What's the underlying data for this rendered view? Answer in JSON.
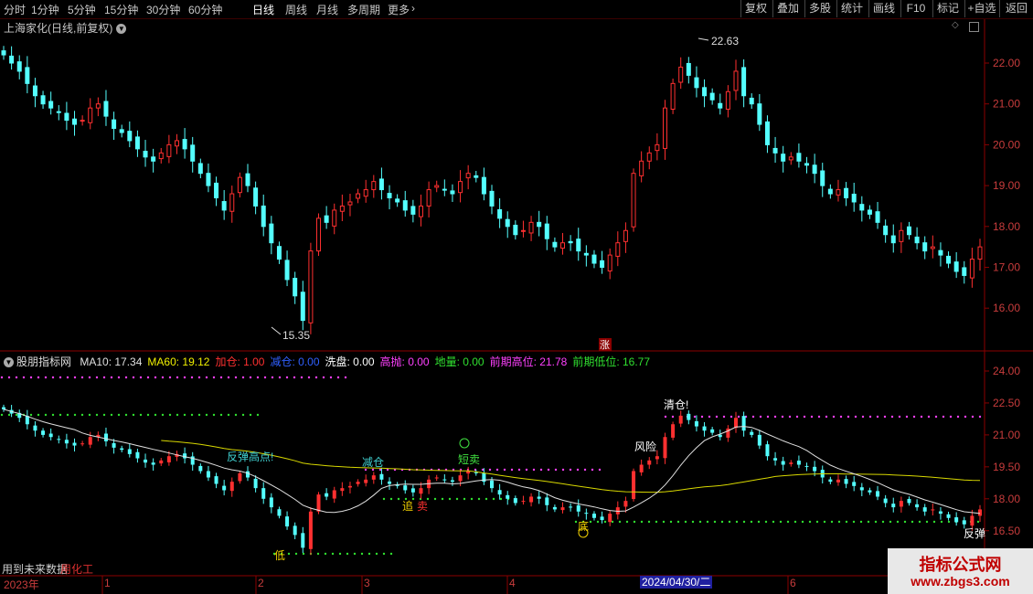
{
  "toolbar": {
    "timeframes": [
      "分时",
      "1分钟",
      "5分钟",
      "15分钟",
      "30分钟",
      "60分钟",
      "日线",
      "周线",
      "月线",
      "多周期",
      "更多"
    ],
    "active_timeframe": "日线",
    "buttons": [
      "复权",
      "叠加",
      "多股",
      "统计",
      "画线",
      "F10",
      "标记",
      "+自选",
      "返回"
    ]
  },
  "stock_title": "上海家化(日线,前复权)",
  "price_axis": [
    "22.00",
    "21.00",
    "20.00",
    "19.00",
    "18.00",
    "17.00",
    "16.00"
  ],
  "high_label": "22.63",
  "low_label": "15.35",
  "limit_up_badge": "涨",
  "indicator": {
    "name": "股朋指标网",
    "items": [
      {
        "label": "MA10:",
        "value": "17.34",
        "color": "#e0e0e0"
      },
      {
        "label": "MA60:",
        "value": "19.12",
        "color": "#f0f000"
      },
      {
        "label": "加仓:",
        "value": "1.00",
        "color": "#ff3030"
      },
      {
        "label": "减仓:",
        "value": "0.00",
        "color": "#3060ff"
      },
      {
        "label": "洗盘:",
        "value": "0.00",
        "color": "#ffffff"
      },
      {
        "label": "高抛:",
        "value": "0.00",
        "color": "#ff40ff"
      },
      {
        "label": "地量:",
        "value": "0.00",
        "color": "#30e030"
      },
      {
        "label": "前期高位:",
        "value": "21.78",
        "color": "#ff40ff"
      },
      {
        "label": "前期低位:",
        "value": "16.77",
        "color": "#30e030"
      }
    ],
    "axis": [
      "24.00",
      "22.50",
      "21.00",
      "19.50",
      "18.00",
      "16.50"
    ],
    "annotations": {
      "rebound_high": "反弹高点!",
      "reduce": "减仓",
      "short_sell": "短卖",
      "clear": "清仓!",
      "risk": "风险",
      "bottom1": "低",
      "bottom2": "底",
      "chase": "追",
      "sell": "卖",
      "rebound": "反弹"
    }
  },
  "date_axis": {
    "year": "2023年",
    "months": [
      "1",
      "2",
      "3",
      "4",
      "6"
    ],
    "selected_date": "2024/04/30/二"
  },
  "footer_note": "用到未来数据",
  "footer_note2": "用化工",
  "watermark": {
    "line1": "指标公式网",
    "line2": "www.zbgs3.com"
  },
  "colors": {
    "up": "#ff3030",
    "down": "#54ffff",
    "ma_short": "#e0e0e0",
    "ma_long": "#d8d800",
    "high_dots": "#ff40ff",
    "low_dots": "#30e030",
    "border": "#8b0000"
  },
  "candle_closes": [
    22.2,
    22.0,
    21.8,
    21.5,
    21.2,
    21.0,
    20.9,
    20.8,
    20.6,
    20.5,
    20.6,
    20.9,
    21.0,
    20.7,
    20.4,
    20.3,
    20.1,
    19.9,
    19.7,
    19.6,
    19.8,
    20.0,
    20.1,
    19.9,
    19.6,
    19.3,
    19.0,
    18.7,
    18.4,
    18.8,
    19.2,
    19.0,
    18.5,
    18.0,
    17.6,
    17.2,
    16.7,
    16.3,
    15.7,
    17.4,
    18.2,
    18.1,
    18.4,
    18.5,
    18.6,
    18.8,
    18.9,
    19.1,
    18.9,
    18.7,
    18.6,
    18.4,
    18.3,
    18.5,
    18.9,
    19.0,
    18.9,
    18.8,
    19.1,
    19.3,
    19.2,
    18.8,
    18.5,
    18.2,
    18.0,
    17.8,
    17.9,
    18.1,
    18.0,
    17.7,
    17.5,
    17.6,
    17.6,
    17.4,
    17.3,
    17.1,
    17.0,
    17.3,
    17.6,
    17.9,
    19.3,
    19.6,
    19.8,
    20.0,
    20.9,
    21.5,
    21.9,
    21.7,
    21.4,
    21.2,
    21.1,
    20.9,
    21.3,
    21.8,
    21.2,
    21.0,
    20.5,
    20.0,
    19.8,
    19.6,
    19.7,
    19.6,
    19.5,
    19.3,
    19.0,
    18.8,
    18.9,
    18.7,
    18.6,
    18.4,
    18.3,
    18.1,
    17.8,
    17.6,
    17.9,
    17.8,
    17.6,
    17.4,
    17.5,
    17.3,
    17.1,
    16.9,
    16.8,
    17.2,
    17.5
  ]
}
